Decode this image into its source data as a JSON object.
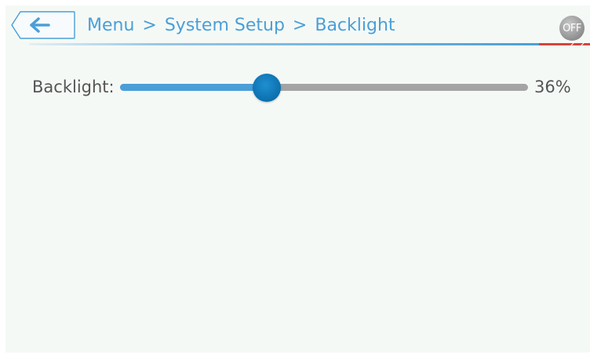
{
  "colors": {
    "accent": "#4a9fd8",
    "thumb": "#0b6fae",
    "track": "#a4a4a4",
    "warning_stripe": "#d9423a",
    "background": "#f5f9f6"
  },
  "header": {
    "back_icon": "left-arrow-icon",
    "breadcrumb": [
      "Menu",
      "System Setup",
      "Backlight"
    ],
    "separator": ">",
    "off_button_label": "OFF"
  },
  "setting": {
    "label": "Backlight:",
    "value_percent": 36,
    "value_text": "36%"
  }
}
